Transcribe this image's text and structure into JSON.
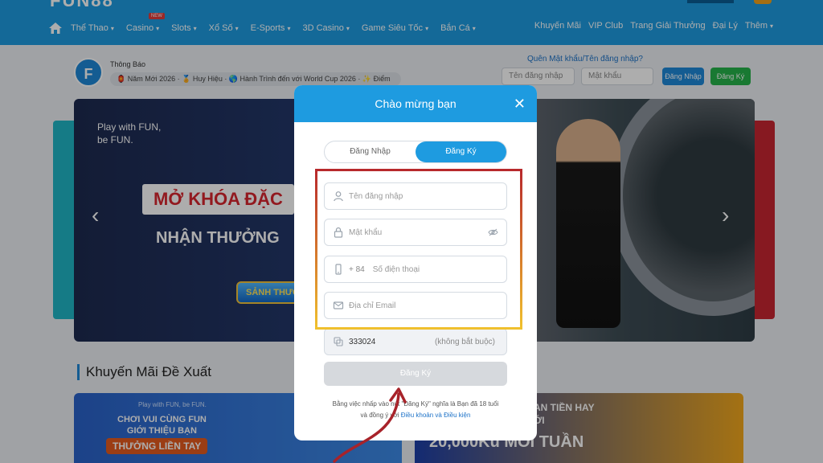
{
  "header": {
    "logo": "FUN88",
    "nav": [
      {
        "label": "Thể Thao",
        "chevron": true
      },
      {
        "label": "Casino",
        "chevron": true,
        "badge": "NEW"
      },
      {
        "label": "Slots",
        "chevron": true
      },
      {
        "label": "Xổ Số",
        "chevron": true
      },
      {
        "label": "E-Sports",
        "chevron": true
      },
      {
        "label": "3D Casino",
        "chevron": true
      },
      {
        "label": "Game Siêu Tốc",
        "chevron": true
      },
      {
        "label": "Bắn Cá",
        "chevron": true
      }
    ],
    "nav_right": [
      {
        "label": "Khuyến Mãi"
      },
      {
        "label": "VIP Club"
      },
      {
        "label": "Trang Giải Thưởng"
      },
      {
        "label": "Đại Lý"
      },
      {
        "label": "Thêm",
        "chevron": true
      }
    ]
  },
  "subheader": {
    "notice_logo": "F",
    "notice_title": "Thông Báo",
    "ticker": "🏮 Năm Mới 2026 · 🏅 Huy Hiệu · 🌎 Hành Trình đến với World Cup 2026 · ✨ Điểm",
    "forgot": "Quên Mật khẩu/Tên đăng nhập?",
    "username_placeholder": "Tên đăng nhập",
    "password_placeholder": "Mật khẩu",
    "login": "Đăng Nhập",
    "register": "Đăng Ký"
  },
  "banner": {
    "tagline_1": "Play with FUN,",
    "tagline_2": "be FUN.",
    "headline_1": "MỞ KHÓA ĐẶC",
    "headline_2": "NHẬN THƯỞNG",
    "cta": "SẢNH THƯỞ",
    "prev": "‹",
    "next": "›"
  },
  "promo": {
    "title": "Khuyến Mãi Đề Xuất",
    "left_tag": "Play with FUN, be FUN.",
    "left_line1": "CHƠI VUI CÙNG FUN",
    "left_line2": "GIỚI THIỆU BẠN",
    "left_cta": "THƯỞNG LIỀN TAY",
    "right_line1": "AN TIỀN HAY",
    "right_line2": "ỚI",
    "right_amount": "20,000Ku MỖI TUẦN"
  },
  "modal": {
    "title": "Chào mừng bạn",
    "close": "✕",
    "tab_login": "Đăng Nhập",
    "tab_register": "Đăng Ký",
    "username_placeholder": "Tên đăng nhập",
    "password_placeholder": "Mật khẩu",
    "phone_prefix": "+ 84",
    "phone_placeholder": "Số điện thoại",
    "email_placeholder": "Địa chỉ Email",
    "referral_value": "333024",
    "referral_note": "(không bắt buộc)",
    "submit": "Đăng Ký",
    "terms_1": "Bằng việc nhấp vào nút \"Đăng Ký\" nghĩa là Bạn đã 18 tuổi",
    "terms_2": "và đồng ý với",
    "terms_link": "Điều khoản và Điều kiện"
  }
}
